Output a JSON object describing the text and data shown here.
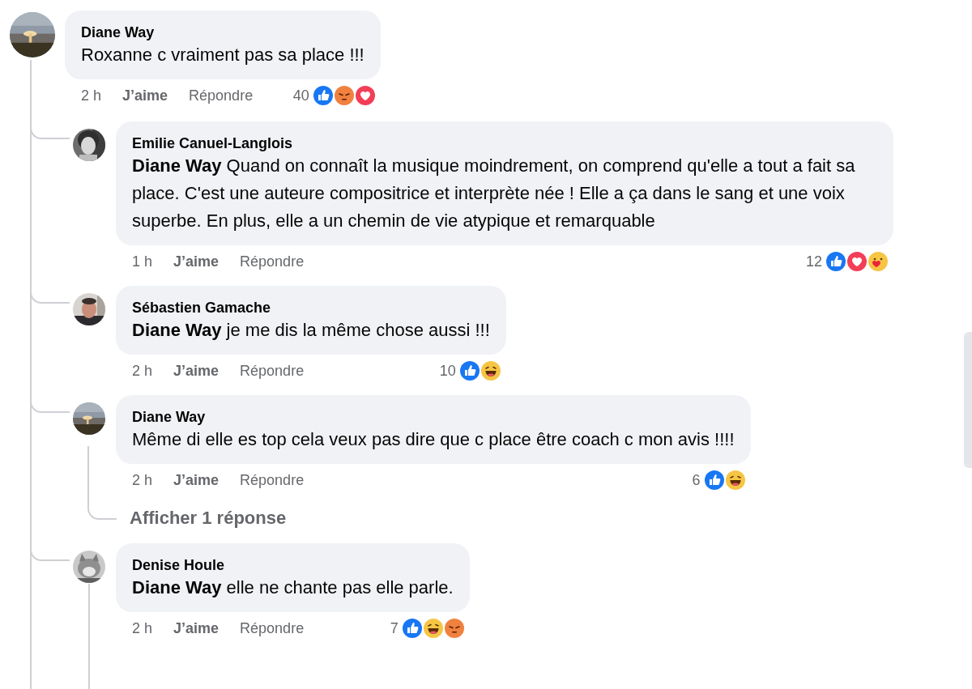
{
  "comment": {
    "author": "Diane Way",
    "text": "Roxanne c vraiment pas sa place !!!",
    "time": "2 h",
    "like_action": "J’aime",
    "reply_action": "Répondre",
    "reaction_count": "40",
    "reactions": [
      {
        "kind": "like"
      },
      {
        "kind": "angry"
      },
      {
        "kind": "love"
      }
    ],
    "replies": [
      {
        "author": "Emilie Canuel-Langlois",
        "text": "**Diane Way** Quand on connaît la musique moindrement, on comprend qu'elle a tout a fait sa place. C'est une auteure compositrice et interprète née ! Elle a ça dans le sang et une voix superbe. En plus, elle a un chemin de vie atypique et remarquable",
        "time": "1 h",
        "like_action": "J’aime",
        "reply_action": "Répondre",
        "reaction_count": "12",
        "reactions": [
          {
            "kind": "like"
          },
          {
            "kind": "love"
          },
          {
            "kind": "care"
          }
        ],
        "thread_line": false
      },
      {
        "author": "Sébastien Gamache",
        "text": "**Diane Way** je me dis la même chose aussi !!!",
        "time": "2 h",
        "like_action": "J’aime",
        "reply_action": "Répondre",
        "reaction_count": "10",
        "reactions": [
          {
            "kind": "like"
          },
          {
            "kind": "haha"
          }
        ],
        "thread_line": false
      },
      {
        "author": "Diane Way",
        "text": "Même di elle es top cela veux pas dire que c place être coach c mon avis !!!!",
        "time": "2 h",
        "like_action": "J’aime",
        "reply_action": "Répondre",
        "reaction_count": "6",
        "reactions": [
          {
            "kind": "like"
          },
          {
            "kind": "haha"
          }
        ],
        "thread_line": true,
        "more_replies": "Afficher 1 réponse"
      },
      {
        "author": "Denise Houle",
        "text": "**Diane Way** elle ne chante pas elle parle.",
        "time": "2 h",
        "like_action": "J’aime",
        "reply_action": "Répondre",
        "reaction_count": "7",
        "reactions": [
          {
            "kind": "like"
          },
          {
            "kind": "haha"
          },
          {
            "kind": "angry"
          }
        ],
        "thread_line": true
      }
    ]
  }
}
